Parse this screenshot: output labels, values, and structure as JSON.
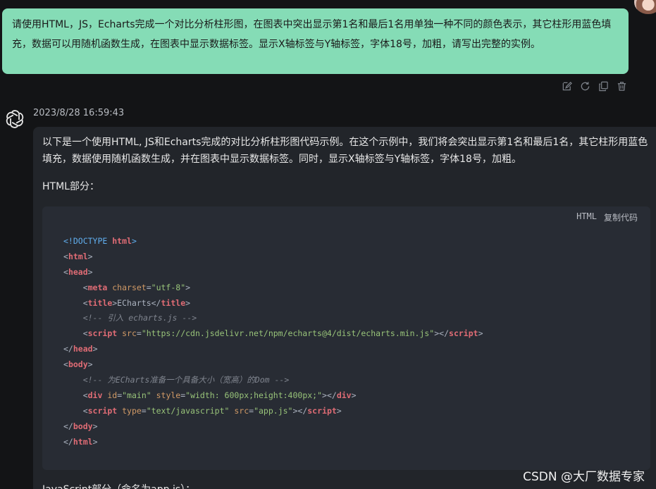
{
  "user_message": {
    "text": "请使用HTML，JS，Echarts完成一个对比分析柱形图，在图表中突出显示第1名和最后1名用单独一种不同的颜色表示，其它柱形用蓝色填充，数据可以用随机函数生成，在图表中显示数据标签。显示X轴标签与Y轴标签，字体18号，加粗，请写出完整的实例。"
  },
  "user_actions": [
    {
      "icon": "edit-icon"
    },
    {
      "icon": "refresh-icon"
    },
    {
      "icon": "copy-icon"
    },
    {
      "icon": "delete-icon"
    }
  ],
  "assistant": {
    "avatar": "openai-logo-icon",
    "timestamp": "2023/8/28 16:59:43",
    "intro": "以下是一个使用HTML, JS和Echarts完成的对比分析柱形图代码示例。在这个示例中，我们将会突出显示第1名和最后1名，其它柱形用蓝色填充，数据使用随机函数生成，并在图表中显示数据标签。同时，显示X轴标签与Y轴标签，字体18号，加粗。",
    "html_label": "HTML部分：",
    "code_lang": "HTML",
    "copy_label": "复制代码",
    "trailing_text": "JavaScript部分（命名为app.js）："
  },
  "code_lines": [
    [
      {
        "t": "<!DOCTYPE ",
        "c": "doctype"
      },
      {
        "t": "html",
        "c": "tag"
      },
      {
        "t": ">",
        "c": "doctype"
      }
    ],
    [
      {
        "t": "<",
        "c": "br"
      },
      {
        "t": "html",
        "c": "tag"
      },
      {
        "t": ">",
        "c": "br"
      }
    ],
    [
      {
        "t": "<",
        "c": "br"
      },
      {
        "t": "head",
        "c": "tag"
      },
      {
        "t": ">",
        "c": "br"
      }
    ],
    [
      {
        "t": "    <",
        "c": "br"
      },
      {
        "t": "meta",
        "c": "tag"
      },
      {
        "t": " charset",
        "c": "attr"
      },
      {
        "t": "=",
        "c": "br"
      },
      {
        "t": "\"utf-8\"",
        "c": "str"
      },
      {
        "t": ">",
        "c": "br"
      }
    ],
    [
      {
        "t": "    <",
        "c": "br"
      },
      {
        "t": "title",
        "c": "tag"
      },
      {
        "t": ">ECharts</",
        "c": "text"
      },
      {
        "t": "title",
        "c": "tag"
      },
      {
        "t": ">",
        "c": "br"
      }
    ],
    [
      {
        "t": "    <!-- 引入 echarts.js -->",
        "c": "com"
      }
    ],
    [
      {
        "t": "    <",
        "c": "br"
      },
      {
        "t": "script",
        "c": "tag"
      },
      {
        "t": " src",
        "c": "attr"
      },
      {
        "t": "=",
        "c": "br"
      },
      {
        "t": "\"https://cdn.jsdelivr.net/npm/echarts@4/dist/echarts.min.js\"",
        "c": "str"
      },
      {
        "t": "></",
        "c": "br"
      },
      {
        "t": "script",
        "c": "tag"
      },
      {
        "t": ">",
        "c": "br"
      }
    ],
    [
      {
        "t": "</",
        "c": "br"
      },
      {
        "t": "head",
        "c": "tag"
      },
      {
        "t": ">",
        "c": "br"
      }
    ],
    [
      {
        "t": "<",
        "c": "br"
      },
      {
        "t": "body",
        "c": "tag"
      },
      {
        "t": ">",
        "c": "br"
      }
    ],
    [
      {
        "t": "    <!-- 为ECharts准备一个具备大小（宽高）的Dom -->",
        "c": "com"
      }
    ],
    [
      {
        "t": "    <",
        "c": "br"
      },
      {
        "t": "div",
        "c": "tag"
      },
      {
        "t": " id",
        "c": "attr"
      },
      {
        "t": "=",
        "c": "br"
      },
      {
        "t": "\"main\"",
        "c": "str"
      },
      {
        "t": " style",
        "c": "attr"
      },
      {
        "t": "=",
        "c": "br"
      },
      {
        "t": "\"width: 600px;height:400px;\"",
        "c": "str"
      },
      {
        "t": "></",
        "c": "br"
      },
      {
        "t": "div",
        "c": "tag"
      },
      {
        "t": ">",
        "c": "br"
      }
    ],
    [
      {
        "t": "    <",
        "c": "br"
      },
      {
        "t": "script",
        "c": "tag"
      },
      {
        "t": " type",
        "c": "attr"
      },
      {
        "t": "=",
        "c": "br"
      },
      {
        "t": "\"text/javascript\"",
        "c": "str"
      },
      {
        "t": " src",
        "c": "attr"
      },
      {
        "t": "=",
        "c": "br"
      },
      {
        "t": "\"app.js\"",
        "c": "str"
      },
      {
        "t": "></",
        "c": "br"
      },
      {
        "t": "script",
        "c": "tag"
      },
      {
        "t": ">",
        "c": "br"
      }
    ],
    [
      {
        "t": "</",
        "c": "br"
      },
      {
        "t": "body",
        "c": "tag"
      },
      {
        "t": ">",
        "c": "br"
      }
    ],
    [
      {
        "t": "</",
        "c": "br"
      },
      {
        "t": "html",
        "c": "tag"
      },
      {
        "t": ">",
        "c": "br"
      }
    ]
  ],
  "watermark": "CSDN @大厂数据专家",
  "colors": {
    "background": "#131416",
    "user_bubble": "#85dcb6",
    "assistant_bubble": "#22252a",
    "code_bg": "#282c34"
  }
}
